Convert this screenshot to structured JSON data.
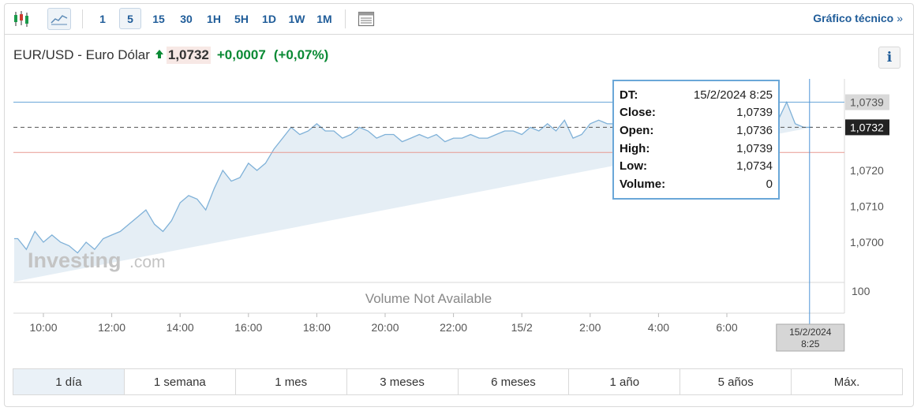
{
  "toolbar": {
    "timeframes": [
      "1",
      "5",
      "15",
      "30",
      "1H",
      "5H",
      "1D",
      "1W",
      "1M"
    ],
    "active_timeframe": "5",
    "tech_link": "Gráfico técnico",
    "tech_arrow": "»"
  },
  "header": {
    "pair": "EUR/USD - Euro Dólar",
    "last": "1,0732",
    "change": "+0,0007",
    "change_pct": "(+0,07%)",
    "info": "i"
  },
  "colors": {
    "up": "#0a8a35",
    "line": "#7fb1d8",
    "fill": "#e5eef5",
    "accent": "#1f5c99"
  },
  "watermark": {
    "brand": "Investing",
    "suffix": ".com"
  },
  "volume_note": "Volume Not Available",
  "tooltip": [
    {
      "key": "DT:",
      "value": "15/2/2024 8:25"
    },
    {
      "key": "Close:",
      "value": "1,0739"
    },
    {
      "key": "Open:",
      "value": "1,0736"
    },
    {
      "key": "High:",
      "value": "1,0739"
    },
    {
      "key": "Low:",
      "value": "1,0734"
    },
    {
      "key": "Volume:",
      "value": "0"
    }
  ],
  "ranges": [
    "1 día",
    "1 semana",
    "1 mes",
    "3 meses",
    "6 meses",
    "1 año",
    "5 años",
    "Máx."
  ],
  "active_range": "1 día",
  "chart_data": {
    "type": "area",
    "x_ticks": [
      "10:00",
      "12:00",
      "14:00",
      "16:00",
      "18:00",
      "20:00",
      "22:00",
      "15/2",
      "2:00",
      "4:00",
      "6:00"
    ],
    "y_ticks": [
      "1,0700",
      "1,0710",
      "1,0720"
    ],
    "volume_tick": "100",
    "ylim": [
      1.0687,
      1.0743
    ],
    "cursor_label": [
      "15/2/2024",
      "8:25"
    ],
    "hline_labels": {
      "high": "1,0739",
      "last": "1,0732"
    },
    "levels": {
      "high": 1.0739,
      "last": 1.0732,
      "prev_close": 1.0725
    },
    "x_hours": [
      9.25,
      9.5,
      9.75,
      10.0,
      10.25,
      10.5,
      10.75,
      11.0,
      11.25,
      11.5,
      11.75,
      12.0,
      12.25,
      12.5,
      12.75,
      13.0,
      13.25,
      13.5,
      13.75,
      14.0,
      14.25,
      14.5,
      14.75,
      15.0,
      15.25,
      15.5,
      15.75,
      16.0,
      16.25,
      16.5,
      16.75,
      17.0,
      17.25,
      17.5,
      17.75,
      18.0,
      18.25,
      18.5,
      18.75,
      19.0,
      19.25,
      19.5,
      19.75,
      20.0,
      20.25,
      20.5,
      20.75,
      21.0,
      21.25,
      21.5,
      21.75,
      22.0,
      22.25,
      22.5,
      22.75,
      23.0,
      23.25,
      23.5,
      23.75,
      24.0,
      24.25,
      24.5,
      24.75,
      25.0,
      25.25,
      25.5,
      25.75,
      26.0,
      26.25,
      26.5,
      26.75,
      27.0,
      27.25,
      27.5,
      27.75,
      28.0,
      28.25,
      28.5,
      28.75,
      29.0,
      29.25,
      29.5,
      29.75,
      30.0,
      30.25,
      30.5,
      30.75,
      31.0,
      31.25,
      31.5,
      31.75,
      32.0,
      32.25,
      32.5,
      32.75
    ],
    "values": [
      1.0701,
      1.0698,
      1.0703,
      1.07,
      1.0702,
      1.07,
      1.0699,
      1.0697,
      1.07,
      1.0698,
      1.0701,
      1.0702,
      1.0703,
      1.0705,
      1.0707,
      1.0709,
      1.0705,
      1.0703,
      1.0706,
      1.0711,
      1.0713,
      1.0712,
      1.0709,
      1.0715,
      1.072,
      1.0717,
      1.0718,
      1.0722,
      1.072,
      1.0722,
      1.0726,
      1.0729,
      1.0732,
      1.073,
      1.0731,
      1.0733,
      1.0731,
      1.0731,
      1.0729,
      1.073,
      1.0732,
      1.0731,
      1.0729,
      1.073,
      1.073,
      1.0728,
      1.0729,
      1.073,
      1.0729,
      1.073,
      1.0728,
      1.0729,
      1.0729,
      1.073,
      1.0729,
      1.0729,
      1.073,
      1.0731,
      1.0731,
      1.073,
      1.0732,
      1.0731,
      1.0733,
      1.0731,
      1.0734,
      1.0729,
      1.073,
      1.0733,
      1.0734,
      1.0733,
      1.0733,
      1.073,
      1.0731,
      1.0733,
      1.0734,
      1.0733,
      1.0734,
      1.0733,
      1.0733,
      1.0733,
      1.0733,
      1.0734,
      1.0734,
      1.0733,
      1.0732,
      1.0732,
      1.0733,
      1.0731,
      1.0732,
      1.0734,
      1.0739,
      1.0733,
      1.0732,
      1.0732
    ]
  }
}
